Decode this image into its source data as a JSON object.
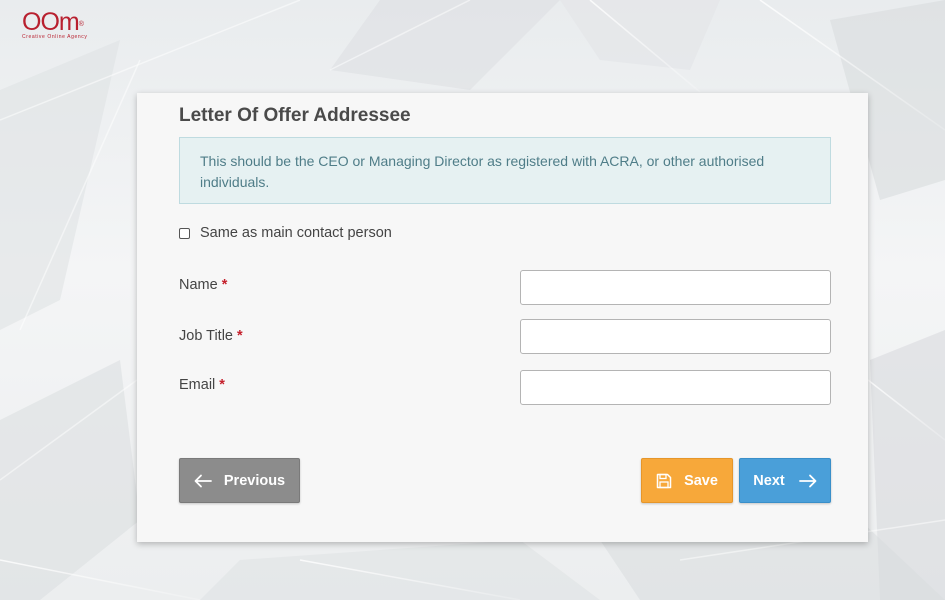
{
  "brand": {
    "logo_text": "OOm",
    "logo_mark": "®",
    "logo_tagline": "Creative Online Agency",
    "color": "#b8202f"
  },
  "form": {
    "title": "Letter Of Offer Addressee",
    "info": "This should be the CEO or Managing Director as registered with ACRA, or other authorised individuals.",
    "same_as_contact_label": "Same as main contact person",
    "same_as_contact_checked": false,
    "required_marker": "*",
    "fields": [
      {
        "label": "Name",
        "value": "",
        "required": true
      },
      {
        "label": "Job Title",
        "value": "",
        "required": true
      },
      {
        "label": "Email",
        "value": "",
        "required": true
      }
    ]
  },
  "actions": {
    "previous_label": "Previous",
    "save_label": "Save",
    "next_label": "Next",
    "previous_icon": "arrow-left-icon",
    "save_icon": "floppy-disk-icon",
    "next_icon": "arrow-right-icon",
    "previous_color": "#8c8c8c",
    "save_color": "#f7a83a",
    "next_color": "#4a9fd9"
  },
  "colors": {
    "info_bg": "#e6f1f2",
    "info_text": "#4f7d88",
    "required": "#c5202c"
  }
}
